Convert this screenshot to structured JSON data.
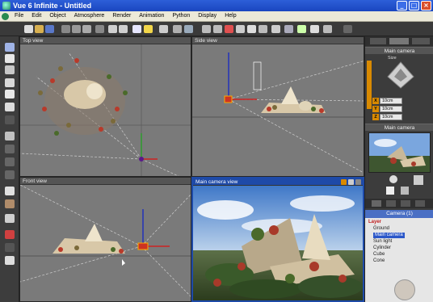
{
  "window": {
    "title": "Vue 6 Infinite - Untitled"
  },
  "menu": {
    "items": [
      "File",
      "Edit",
      "Object",
      "Atmosphere",
      "Render",
      "Animation",
      "Python",
      "Display",
      "Help"
    ]
  },
  "viewports": {
    "top": {
      "label": "Top view"
    },
    "side": {
      "label": "Side view"
    },
    "front": {
      "label": "Front view"
    },
    "camera": {
      "label": "Main camera view"
    }
  },
  "object_panel": {
    "title": "Main camera",
    "size_label": "Size",
    "x_value": "10cm",
    "y_value": "10cm",
    "z_value": "10cm"
  },
  "preview": {
    "title": "Main camera"
  },
  "world_browser": {
    "title": "Camera (1)",
    "layer": "Layer",
    "items": [
      "Ground",
      "Main camera",
      "Sun light",
      "Cylinder",
      "Cube",
      "Cone"
    ]
  },
  "colors": {
    "titlebar": "#1a46c0",
    "selection": "#2b57c9",
    "accent": "#d98a00"
  }
}
